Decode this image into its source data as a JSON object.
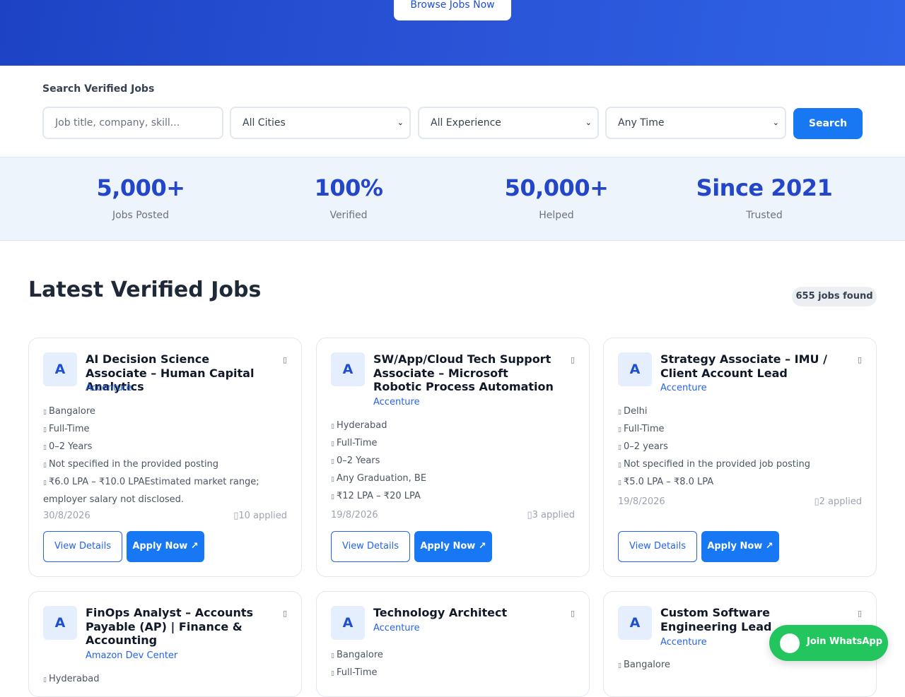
{
  "hero": {
    "browse_label": "Browse Jobs Now"
  },
  "search": {
    "title": "Search Verified Jobs",
    "placeholder": "Job title, company, skill...",
    "city": "All Cities",
    "experience": "All Experience",
    "time": "Any Time",
    "button": " Search"
  },
  "stats": [
    {
      "value": "5,000+",
      "label": "Jobs Posted"
    },
    {
      "value": "100%",
      "label": "Verified"
    },
    {
      "value": "50,000+",
      "label": "Helped"
    },
    {
      "value": "Since 2021",
      "label": "Trusted"
    }
  ],
  "section": {
    "title": "Latest Verified Jobs",
    "count": "655 jobs found"
  },
  "jobs": [
    {
      "logo": "A",
      "title": "AI Decision Science Associate – Human Capital Analytics",
      "company": "Accenture",
      "meta": [
        "Bangalore",
        "Full-Time",
        "0–2 Years",
        "Not specified in the provided posting",
        "₹6.0 LPA – ₹10.0 LPAEstimated market range; employer salary not disclosed."
      ],
      "date": "30/8/2026",
      "applied": "10 applied",
      "view": "View Details",
      "apply": "Apply Now ↗"
    },
    {
      "logo": "A",
      "title": "SW/App/Cloud Tech Support Associate – Microsoft Robotic Process Automation",
      "company": "Accenture",
      "meta": [
        "Hyderabad",
        "Full-Time",
        "0–2 Years",
        "Any Graduation, BE",
        "₹12 LPA – ₹20 LPA"
      ],
      "date": "19/8/2026",
      "applied": "3 applied",
      "view": "View Details",
      "apply": "Apply Now ↗"
    },
    {
      "logo": "A",
      "title": "Strategy Associate – IMU / Client Account Lead",
      "company": "Accenture",
      "meta": [
        "Delhi",
        "Full-Time",
        "0–2 years",
        "Not specified in the provided job posting",
        "₹5.0 LPA – ₹8.0 LPA"
      ],
      "date": "19/8/2026",
      "applied": "2 applied",
      "view": "View Details",
      "apply": "Apply Now ↗"
    },
    {
      "logo": "A",
      "title": "FinOps Analyst – Accounts Payable (AP) | Finance & Accounting",
      "company": "Amazon Dev Center",
      "meta": [
        "Hyderabad"
      ]
    },
    {
      "logo": "A",
      "title": "Technology Architect",
      "company": "Accenture",
      "meta": [
        "Bangalore",
        "Full-Time"
      ]
    },
    {
      "logo": "A",
      "title": "Custom Software Engineering Lead",
      "company": "Accenture",
      "meta": [
        "Bangalore"
      ]
    }
  ],
  "whatsapp": {
    "label": "Join WhatsApp"
  }
}
